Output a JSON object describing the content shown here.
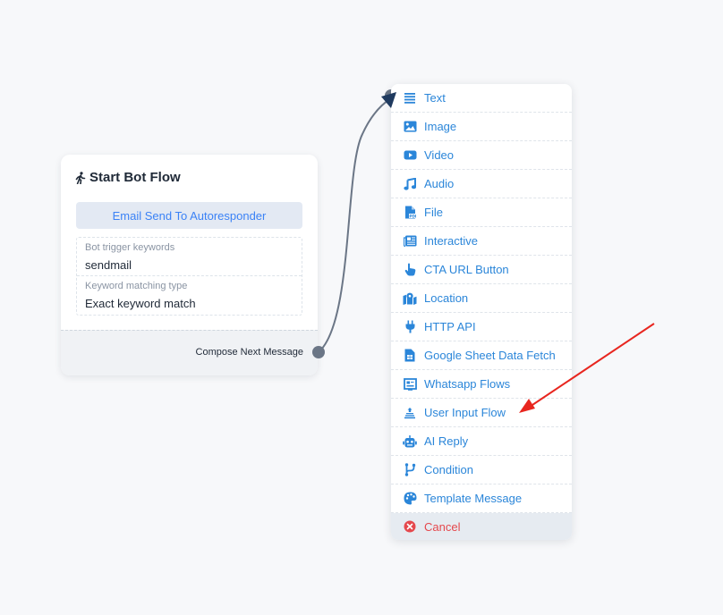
{
  "start_card": {
    "title": "Start Bot Flow",
    "autoresponder_label": "Email Send To Autoresponder",
    "trigger_keywords_label": "Bot trigger keywords",
    "trigger_keywords_value": "sendmail",
    "matching_type_label": "Keyword matching type",
    "matching_type_value": "Exact keyword match",
    "compose_label": "Compose Next Message"
  },
  "menu": {
    "items": [
      {
        "label": "Text",
        "icon": "text-icon"
      },
      {
        "label": "Image",
        "icon": "image-icon"
      },
      {
        "label": "Video",
        "icon": "video-icon"
      },
      {
        "label": "Audio",
        "icon": "music-note-icon"
      },
      {
        "label": "File",
        "icon": "pdf-file-icon"
      },
      {
        "label": "Interactive",
        "icon": "newspaper-icon"
      },
      {
        "label": "CTA URL Button",
        "icon": "pointer-hand-icon"
      },
      {
        "label": "Location",
        "icon": "map-location-icon"
      },
      {
        "label": "HTTP API",
        "icon": "plug-icon"
      },
      {
        "label": "Google Sheet Data Fetch",
        "icon": "spreadsheet-icon"
      },
      {
        "label": "Whatsapp Flows",
        "icon": "flow-screen-icon"
      },
      {
        "label": "User Input Flow",
        "icon": "user-input-icon"
      },
      {
        "label": "AI Reply",
        "icon": "robot-icon"
      },
      {
        "label": "Condition",
        "icon": "branch-icon"
      },
      {
        "label": "Template Message",
        "icon": "palette-icon"
      }
    ],
    "cancel_label": "Cancel",
    "cancel_icon": "close-circle-icon"
  },
  "colors": {
    "menu_text": "#2b86d9",
    "cancel": "#e5484d",
    "connector": "#6b7686",
    "annotation_arrow": "#e8261f"
  }
}
